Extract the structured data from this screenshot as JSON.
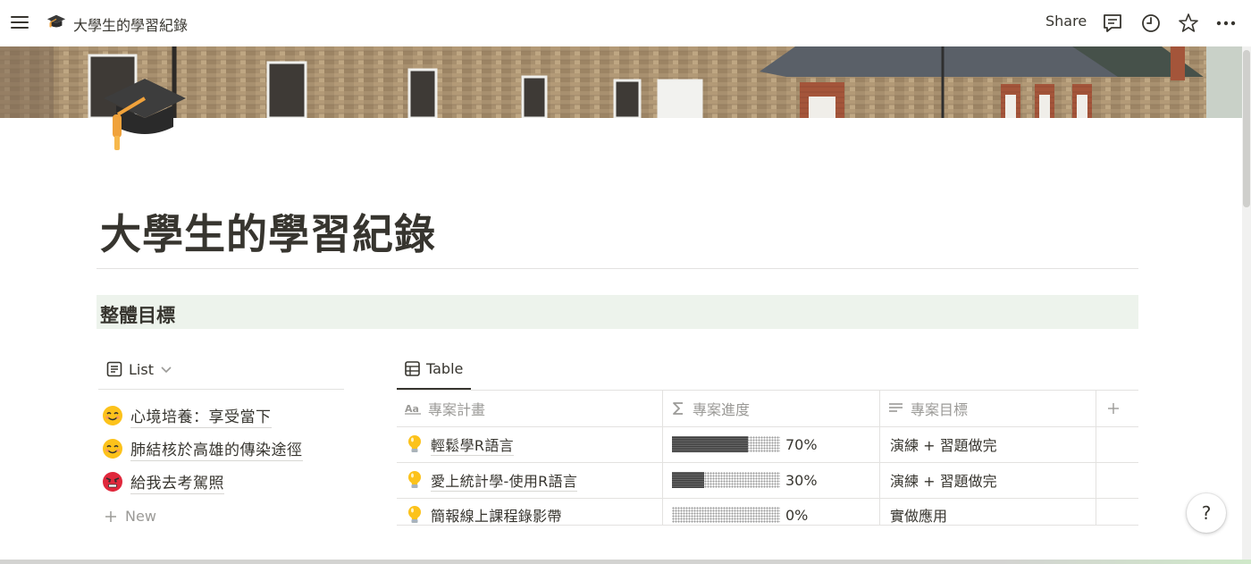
{
  "topbar": {
    "breadcrumb_title": "大學生的學習紀錄",
    "share_label": "Share",
    "icons": [
      "menu-icon",
      "comment-icon",
      "clock-icon",
      "star-icon",
      "more-icon"
    ]
  },
  "page": {
    "icon": "graduation-cap-icon",
    "title": "大學生的學習紀錄",
    "section_heading": "整體目標",
    "section_heading_color": "#edf3ec"
  },
  "list_view": {
    "tab_label": "List",
    "items": [
      {
        "emoji": "smiling-face-icon",
        "label": "心境培養：享受當下"
      },
      {
        "emoji": "smiling-face-icon",
        "label": "肺結核於高雄的傳染途徑"
      },
      {
        "emoji": "angry-face-icon",
        "label": "給我去考駕照"
      }
    ],
    "new_label": "New"
  },
  "table_view": {
    "tab_label": "Table",
    "columns": [
      {
        "icon": "text-aa-icon",
        "label": "專案計畫"
      },
      {
        "icon": "sigma-icon",
        "label": "專案進度"
      },
      {
        "icon": "lines-icon",
        "label": "專案目標"
      }
    ],
    "rows": [
      {
        "icon": "lightbulb-icon",
        "name": "輕鬆學R語言",
        "progress": 0.7,
        "progress_label": "70%",
        "goal": "演練 + 習題做完"
      },
      {
        "icon": "lightbulb-icon",
        "name": "愛上統計學-使用R語言",
        "progress": 0.3,
        "progress_label": "30%",
        "goal": "演練 + 習題做完"
      },
      {
        "icon": "lightbulb-icon",
        "name": "簡報線上課程錄影帶",
        "progress": 0,
        "progress_label": "0%",
        "goal": "實做應用"
      }
    ]
  },
  "help": {
    "label": "?"
  }
}
